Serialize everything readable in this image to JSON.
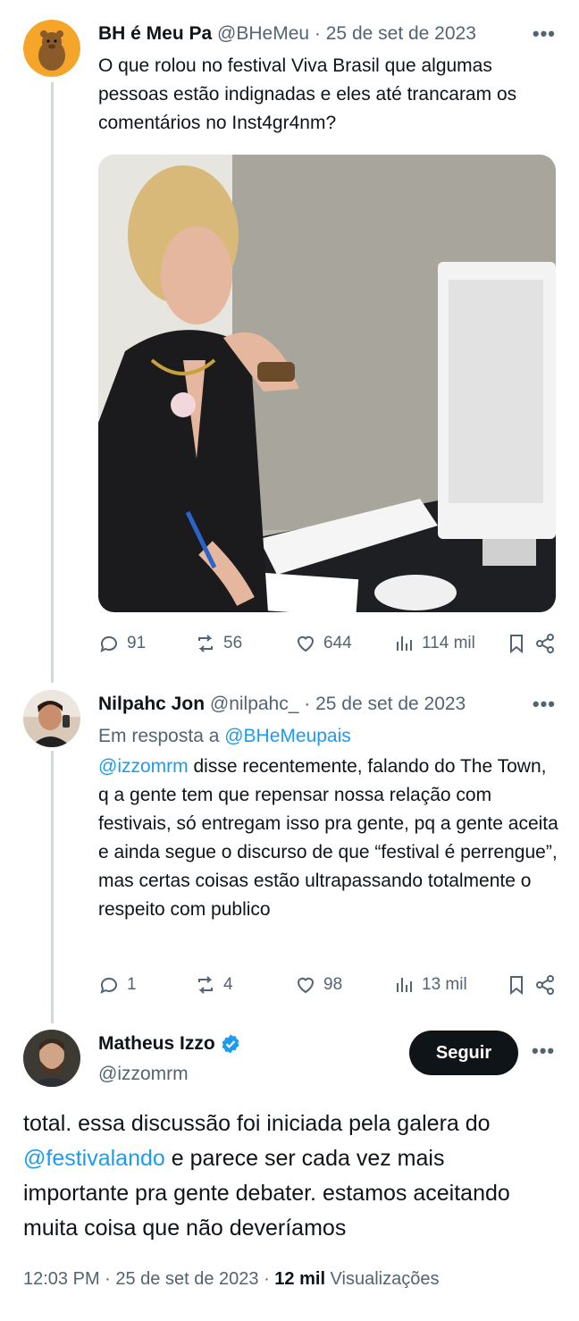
{
  "tweet1": {
    "name": "BH é Meu Pa",
    "handle": "@BHeMeu",
    "time": "· 25 de set de 2023",
    "more": "•••",
    "text": "O que rolou no festival Viva Brasil que algumas pessoas estão indignadas e eles até trancaram os comentários no Inst4gr4nm?",
    "stats": {
      "replies": "91",
      "retweets": "56",
      "likes": "644",
      "views": "114 mil"
    }
  },
  "tweet2": {
    "name": "Nilpahc Jon",
    "handle": "@nilpahc_",
    "time": "· 25 de set de 2023",
    "more": "•••",
    "reply_prefix": "Em resposta a ",
    "reply_to": "@BHeMeupais",
    "mention": "@izzomrm",
    "text": " disse recentemente, falando do The Town, q a gente tem que repensar nossa relação com festivais, só entregam isso pra gente, pq a gente aceita e ainda segue o discurso de que “festival é perrengue”, mas certas coisas estão ultrapassando totalmente o respeito com publico",
    "stats": {
      "replies": "1",
      "retweets": "4",
      "likes": "98",
      "views": "13 mil"
    }
  },
  "main": {
    "name": "Matheus Izzo",
    "handle": "@izzomrm",
    "follow_label": "Seguir",
    "more": "•••",
    "text_part1": "total. essa discussão foi iniciada pela galera do ",
    "mention": "@festivalando",
    "text_part2": " e parece ser cada vez mais importante pra gente debater. estamos aceitando muita coisa que não deveríamos",
    "footer_time": "12:03 PM · 25 de set de 2023 · ",
    "footer_views": "12 mil",
    "footer_views_label": " Visualizações"
  },
  "colors": {
    "accent": "#1d9bf0",
    "text": "#0f1419",
    "muted": "#536471",
    "line": "#cfd9de"
  }
}
